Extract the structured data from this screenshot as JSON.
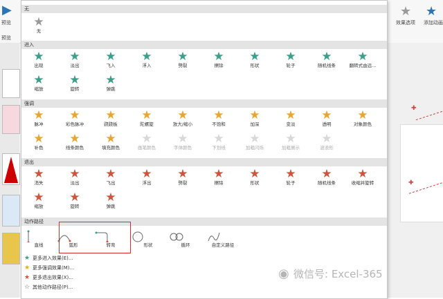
{
  "ribbon": {
    "left_label": "预览",
    "left_sub": "预览",
    "right_label1": "效果选项",
    "right_label2": "添加动画"
  },
  "gallery": {
    "none": {
      "header": "无",
      "items": [
        {
          "label": "无",
          "icon": "star-outline"
        }
      ]
    },
    "entrance": {
      "header": "进入",
      "items": [
        {
          "label": "出现"
        },
        {
          "label": "淡出"
        },
        {
          "label": "飞入"
        },
        {
          "label": "浮入"
        },
        {
          "label": "劈裂"
        },
        {
          "label": "擦除"
        },
        {
          "label": "形状"
        },
        {
          "label": "轮子"
        },
        {
          "label": "随机线条"
        },
        {
          "label": "翻转式由远..."
        },
        {
          "label": "缩放"
        },
        {
          "label": "旋转"
        },
        {
          "label": "弹跳"
        }
      ]
    },
    "emphasis": {
      "header": "强调",
      "items": [
        {
          "label": "脉冲"
        },
        {
          "label": "彩色脉冲"
        },
        {
          "label": "跷跷板"
        },
        {
          "label": "陀螺旋"
        },
        {
          "label": "放大/缩小"
        },
        {
          "label": "不饱和"
        },
        {
          "label": "加深"
        },
        {
          "label": "变淡"
        },
        {
          "label": "透明"
        },
        {
          "label": "对象颜色"
        },
        {
          "label": "补色"
        },
        {
          "label": "线条颜色"
        },
        {
          "label": "填充颜色"
        },
        {
          "label": "画笔颜色",
          "disabled": true
        },
        {
          "label": "字体颜色",
          "disabled": true
        },
        {
          "label": "下划线",
          "disabled": true
        },
        {
          "label": "加粗闪烁",
          "disabled": true
        },
        {
          "label": "加粗展示",
          "disabled": true
        },
        {
          "label": "波浪形",
          "disabled": true
        }
      ]
    },
    "exit": {
      "header": "退出",
      "items": [
        {
          "label": "消失"
        },
        {
          "label": "淡出"
        },
        {
          "label": "飞出"
        },
        {
          "label": "浮出"
        },
        {
          "label": "劈裂"
        },
        {
          "label": "擦除"
        },
        {
          "label": "形状"
        },
        {
          "label": "轮子"
        },
        {
          "label": "随机线条"
        },
        {
          "label": "收缩并旋转"
        },
        {
          "label": "缩放"
        },
        {
          "label": "旋转"
        },
        {
          "label": "弹跳"
        }
      ]
    },
    "motion": {
      "header": "动作路径",
      "items": [
        {
          "label": "直线"
        },
        {
          "label": "弧形"
        },
        {
          "label": "转弯"
        },
        {
          "label": "形状"
        },
        {
          "label": "循环"
        },
        {
          "label": "自定义路径"
        }
      ]
    },
    "menu": [
      {
        "label": "更多进入效果(E)...",
        "color": "#3a9e8a"
      },
      {
        "label": "更多强调效果(M)...",
        "color": "#e8a530"
      },
      {
        "label": "更多退出效果(X)...",
        "color": "#d0533c"
      },
      {
        "label": "其他动作路径(P)...",
        "color": "#666666"
      }
    ]
  },
  "watermark": "微信号: Excel-365",
  "colors": {
    "highlight_box": "#d12d2d",
    "entrance": "#3a9e8a",
    "emphasis": "#e8a530",
    "exit": "#d0533c"
  }
}
